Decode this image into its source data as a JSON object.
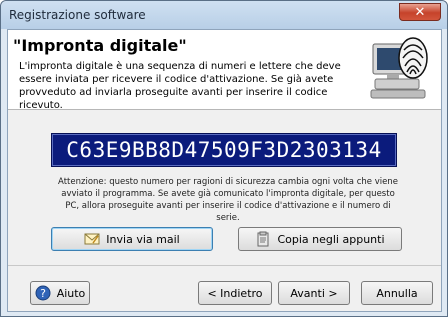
{
  "window": {
    "title": "Registrazione software",
    "close_glyph": "✕"
  },
  "header": {
    "heading": "\"Impronta digitale\"",
    "intro": "L'impronta digitale è una sequenza di numeri e lettere che deve essere inviata per ricevere il codice d'attivazione. Se già avete provveduto ad inviarla proseguite avanti per inserire il codice ricevuto.",
    "illustration_icon": "computer-fingerprint-icon"
  },
  "code": {
    "value": "C63E9BB8D47509F3D2303134"
  },
  "note": "Attenzione: questo numero per ragioni di sicurezza cambia ogni volta che viene avviato il programma. Se avete già comunicato l'impronta digitale, per questo PC, allora proseguite avanti per inserire il codice d'attivazione e il numero di serie.",
  "actions": {
    "send_mail": "Invia via mail",
    "copy": "Copia negli appunti"
  },
  "footer": {
    "help": "Aiuto",
    "back": "< Indietro",
    "next": "Avanti >",
    "cancel": "Annulla"
  },
  "colors": {
    "code_background": "#0b1b7c",
    "code_text": "#ffffff",
    "title_gradient": "#b8cfe7"
  }
}
